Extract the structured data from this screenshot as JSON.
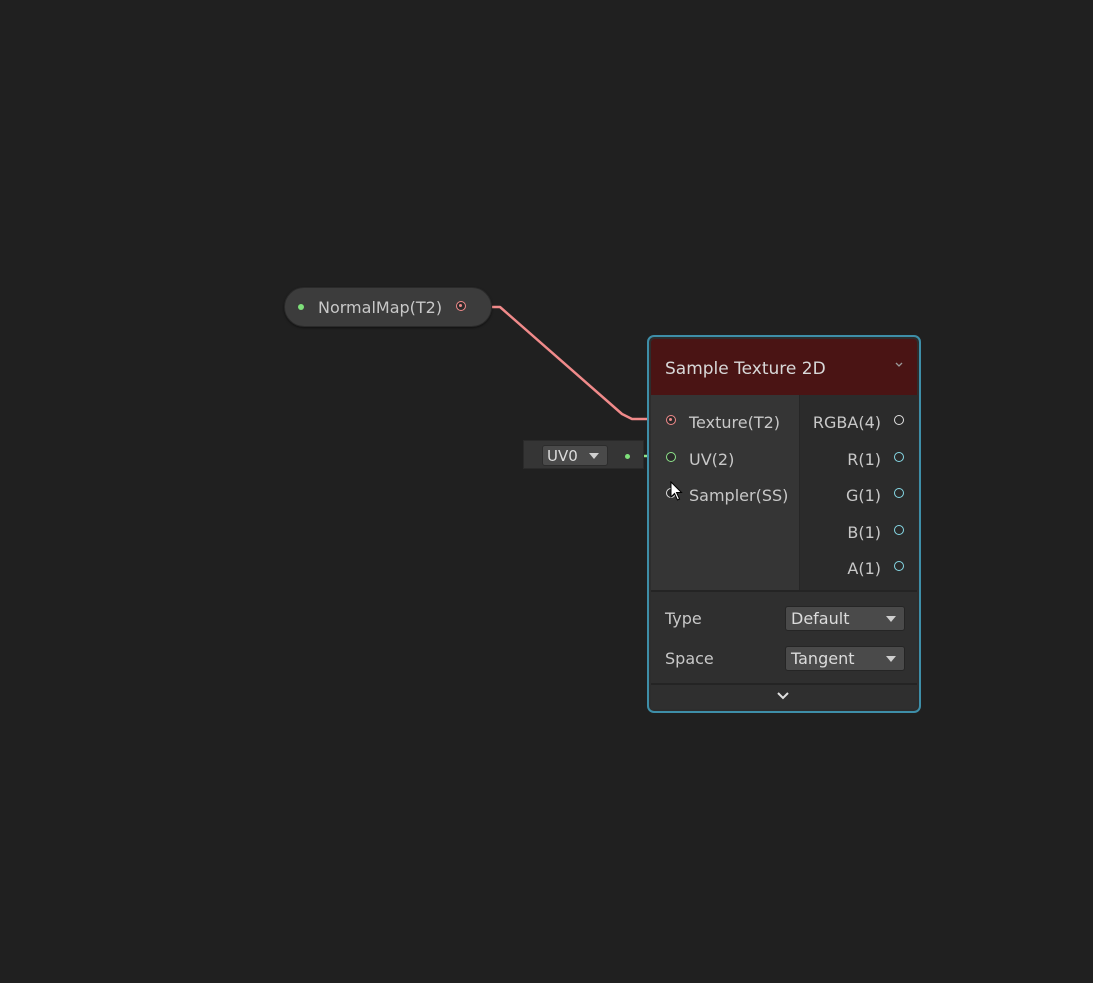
{
  "property_node": {
    "label": "NormalMap(T2)"
  },
  "uv_input": {
    "selected": "UV0"
  },
  "node": {
    "title": "Sample Texture 2D",
    "inputs": [
      {
        "label": "Texture(T2)"
      },
      {
        "label": "UV(2)"
      },
      {
        "label": "Sampler(SS)"
      }
    ],
    "outputs": [
      {
        "label": "RGBA(4)"
      },
      {
        "label": "R(1)"
      },
      {
        "label": "G(1)"
      },
      {
        "label": "B(1)"
      },
      {
        "label": "A(1)"
      }
    ],
    "settings": {
      "type_label": "Type",
      "type_value": "Default",
      "space_label": "Space",
      "space_value": "Tangent"
    }
  },
  "colors": {
    "background": "#202020",
    "texture_wire": "#f08a8a",
    "vector2_wire": "#8ee48a",
    "float_port": "#86d9e6",
    "node_header": "#4a1414",
    "selection_border": "#3e8ea8"
  }
}
